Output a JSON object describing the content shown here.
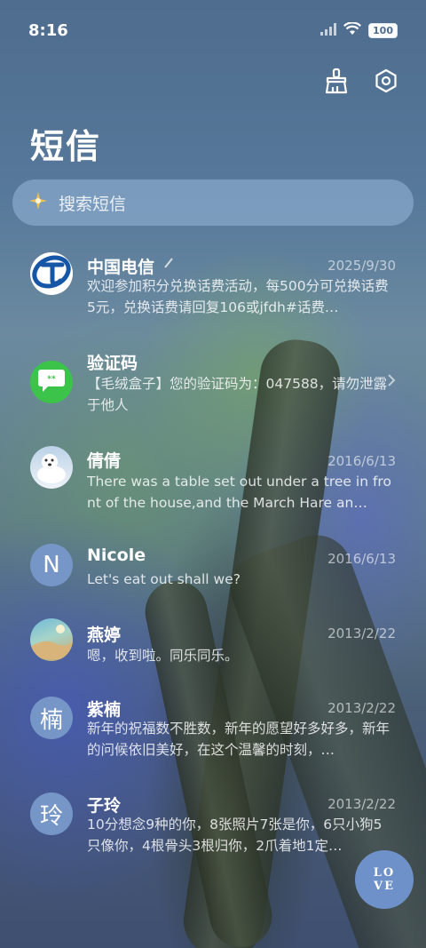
{
  "status_bar": {
    "time": "8:16",
    "battery": "100"
  },
  "page": {
    "title": "短信"
  },
  "search": {
    "placeholder": "搜索短信"
  },
  "conversations": [
    {
      "name": "中国电信",
      "date": "2025/9/30",
      "preview": "欢迎参加积分兑换话费活动，每500分可兑换话费5元，兑换话费请回复106或jfdh#话费…",
      "avatar": "china-telecom-logo"
    },
    {
      "name": "验证码",
      "date": "",
      "preview": "【毛绒盒子】您的验证码为：047588，请勿泄露于他人",
      "avatar": "message-bubble-icon"
    },
    {
      "name": "倩倩",
      "date": "2016/6/13",
      "preview": "There was a table set out under a tree in front of the house,and the March Hare an…",
      "avatar": "polar-bear-photo"
    },
    {
      "name": "Nicole",
      "date": "2016/6/13",
      "preview": "Let's eat out shall we?",
      "avatar_letter": "N"
    },
    {
      "name": "燕婷",
      "date": "2013/2/22",
      "preview": "嗯，收到啦。同乐同乐。",
      "avatar": "landscape-photo"
    },
    {
      "name": "紫楠",
      "date": "2013/2/22",
      "preview": "新年的祝福数不胜数，新年的愿望好多好多，新年的问候依旧美好，在这个温馨的时刻，…",
      "avatar_letter": "楠"
    },
    {
      "name": "子玲",
      "date": "2013/2/22",
      "preview": "10分想念9种的你，8张照片7张是你，6只小狗5只像你，4根骨头3根归你，2爪着地1定…",
      "avatar_letter": "玲"
    }
  ],
  "fab": {
    "line1": "LO",
    "line2": "VE"
  },
  "colors": {
    "accent": "#6f91c9",
    "telecom_blue": "#1556a6",
    "message_green": "#3cc34a"
  }
}
